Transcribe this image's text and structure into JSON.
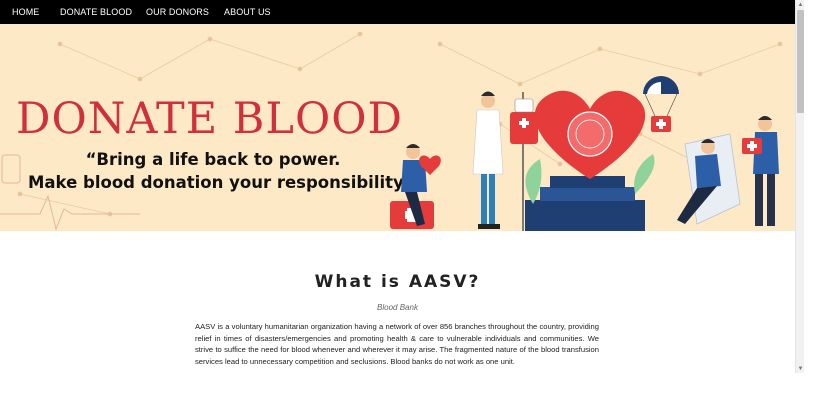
{
  "nav": {
    "items": [
      "HOME",
      "DONATE BLOOD",
      "OUR DONORS",
      "ABOUT US"
    ]
  },
  "hero": {
    "title": "DONATE BLOOD",
    "quote_line1": "“Bring a life back to power.",
    "quote_line2": "Make blood donation your responsibility”"
  },
  "about": {
    "heading": "What is AASV?",
    "subheading": "Blood Bank",
    "body": "AASV is a voluntary humanitarian organization having a network of over 856 branches throughout the country, providing relief in times of disasters/emergencies and promoting health & care to vulnerable individuals and communities. We strive to suffice the need for blood whenever and wherever it may arise. The fragmented nature of the blood transfusion services lead to unnecessary competition and seclusions. Blood banks do not work as one unit."
  },
  "colors": {
    "nav_bg": "#000000",
    "hero_bg": "#fde9c6",
    "title_red": "#d0303d",
    "accent_blue": "#1f4e8c"
  },
  "icons": {
    "scroll_up": "scroll-up-arrow-icon",
    "scroll_down": "scroll-down-arrow-icon"
  }
}
